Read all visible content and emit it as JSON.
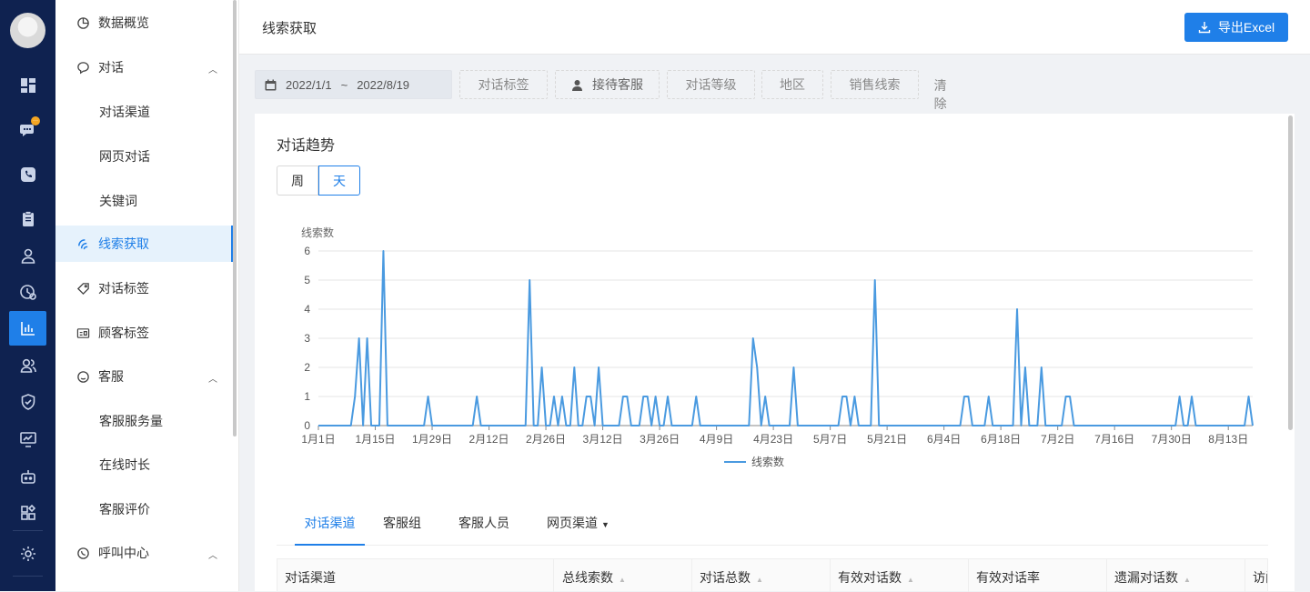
{
  "sidebar": {
    "items": [
      {
        "label": "数据概览",
        "icon": "pie-chart-icon"
      },
      {
        "label": "对话",
        "icon": "chat-bubble-icon"
      },
      {
        "label": "对话渠道"
      },
      {
        "label": "网页对话"
      },
      {
        "label": "关键词"
      },
      {
        "label": "线索获取",
        "icon": "magnet-icon"
      },
      {
        "label": "对话标签",
        "icon": "tag-icon"
      },
      {
        "label": "顾客标签",
        "icon": "id-card-icon"
      },
      {
        "label": "客服",
        "icon": "service-chat-icon"
      },
      {
        "label": "客服服务量"
      },
      {
        "label": "在线时长"
      },
      {
        "label": "客服评价"
      },
      {
        "label": "呼叫中心",
        "icon": "phone-chat-icon"
      }
    ]
  },
  "header": {
    "title": "线索获取",
    "export_label": "导出Excel"
  },
  "filters": {
    "date_start": "2022/1/1",
    "date_sep": "~",
    "date_end": "2022/8/19",
    "tag": "对话标签",
    "agent": "接待客服",
    "level": "对话等级",
    "region": "地区",
    "leads": "销售线索",
    "clear": "清除筛选条件"
  },
  "card": {
    "title": "对话趋势",
    "toggle_week": "周",
    "toggle_day": "天"
  },
  "chart_data": {
    "type": "line",
    "ylabel": "线索数",
    "ylim": [
      0,
      6
    ],
    "yticks": [
      0,
      1,
      2,
      3,
      4,
      5,
      6
    ],
    "xtick_labels": [
      "1月1日",
      "1月15日",
      "1月29日",
      "2月12日",
      "2月26日",
      "3月12日",
      "3月26日",
      "4月9日",
      "4月23日",
      "5月7日",
      "5月21日",
      "6月4日",
      "6月18日",
      "7月2日",
      "7月16日",
      "7月30日",
      "8月13日"
    ],
    "xtick_day_index": [
      0,
      14,
      28,
      42,
      56,
      70,
      84,
      98,
      112,
      126,
      140,
      154,
      168,
      182,
      196,
      210,
      224
    ],
    "total_days": 231,
    "legend": "线索数",
    "legend_position": "bottom-center",
    "grid": true,
    "nonzero_days": [
      [
        9,
        1
      ],
      [
        10,
        3
      ],
      [
        11,
        0
      ],
      [
        12,
        3
      ],
      [
        13,
        0
      ],
      [
        16,
        6
      ],
      [
        27,
        1
      ],
      [
        39,
        1
      ],
      [
        52,
        5
      ],
      [
        54,
        0
      ],
      [
        55,
        2
      ],
      [
        58,
        1
      ],
      [
        59,
        0
      ],
      [
        60,
        1
      ],
      [
        62,
        0
      ],
      [
        63,
        2
      ],
      [
        66,
        1
      ],
      [
        67,
        1
      ],
      [
        68,
        0
      ],
      [
        69,
        2
      ],
      [
        75,
        1
      ],
      [
        76,
        1
      ],
      [
        80,
        1
      ],
      [
        81,
        1
      ],
      [
        83,
        1
      ],
      [
        86,
        1
      ],
      [
        93,
        1
      ],
      [
        107,
        3
      ],
      [
        108,
        2
      ],
      [
        110,
        1
      ],
      [
        117,
        2
      ],
      [
        129,
        1
      ],
      [
        130,
        1
      ],
      [
        132,
        1
      ],
      [
        137,
        5
      ],
      [
        159,
        1
      ],
      [
        160,
        1
      ],
      [
        165,
        1
      ],
      [
        172,
        4
      ],
      [
        174,
        2
      ],
      [
        178,
        2
      ],
      [
        184,
        1
      ],
      [
        185,
        1
      ],
      [
        212,
        1
      ],
      [
        215,
        1
      ],
      [
        229,
        1
      ]
    ]
  },
  "tabs": [
    {
      "label": "对话渠道"
    },
    {
      "label": "客服组"
    },
    {
      "label": "客服人员"
    },
    {
      "label": "网页渠道"
    }
  ],
  "table": {
    "columns": [
      "对话渠道",
      "总线索数",
      "对话总数",
      "有效对话数",
      "有效对话率",
      "遗漏对话数",
      "访问"
    ]
  }
}
